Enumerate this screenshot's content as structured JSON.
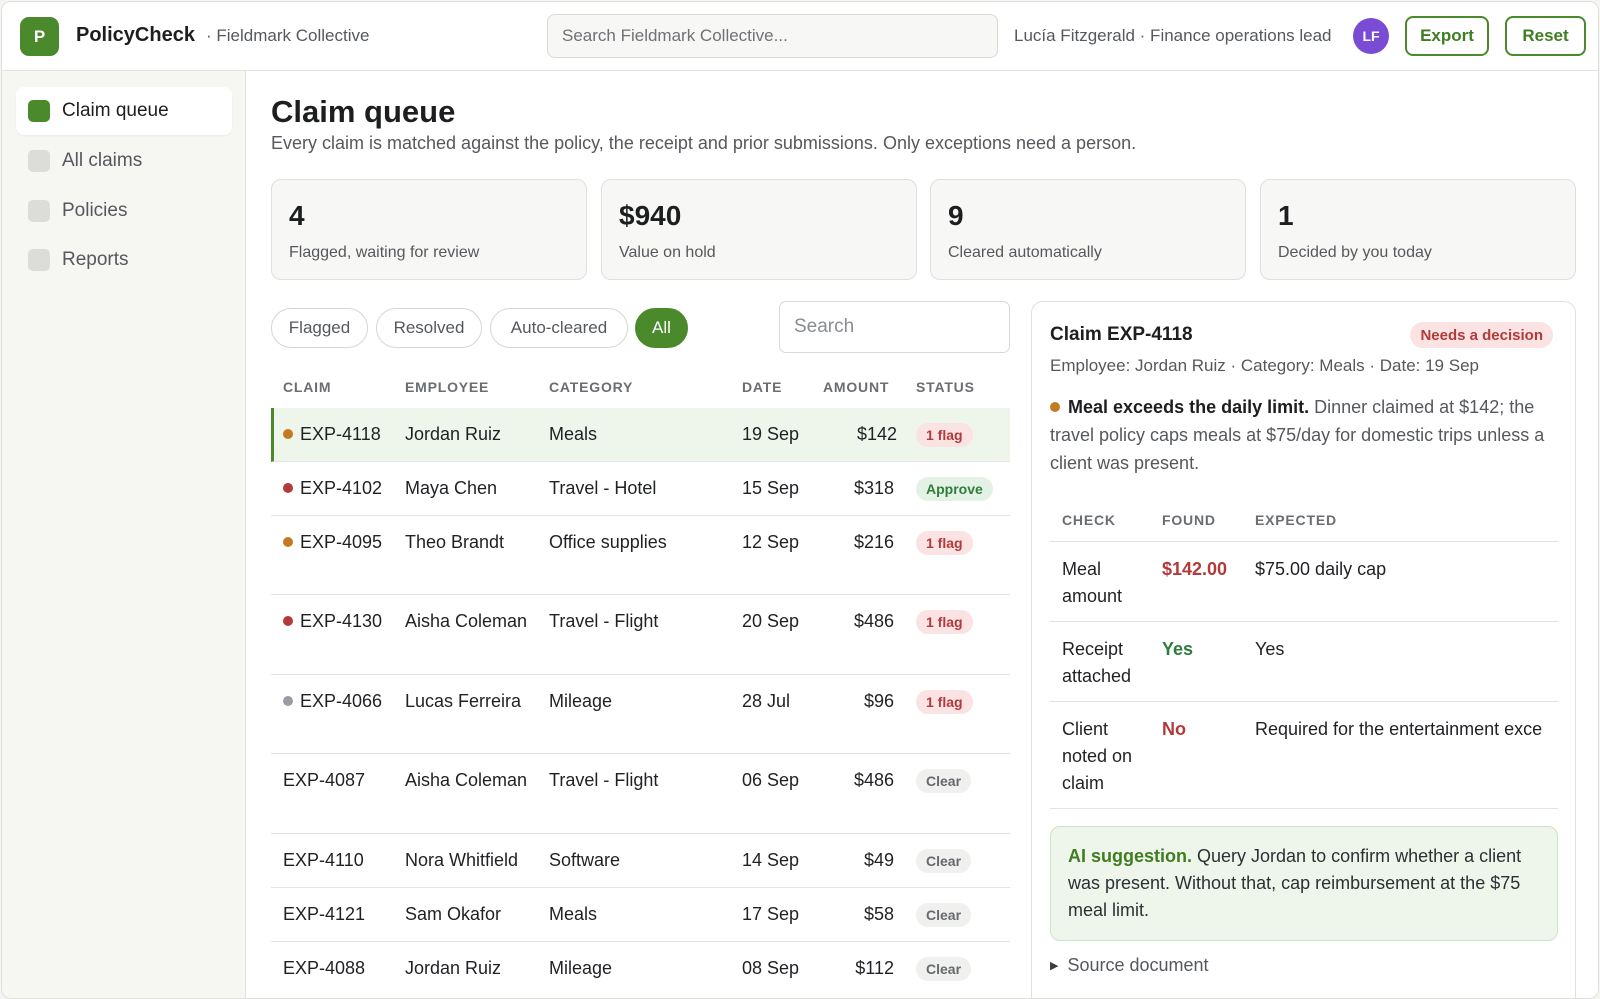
{
  "header": {
    "logo_letter": "P",
    "app_name": "PolicyCheck",
    "org": "· Fieldmark Collective",
    "search_placeholder": "Search Fieldmark Collective...",
    "user": "Lucía Fitzgerald · Finance operations lead",
    "avatar_initials": "LF",
    "export_label": "Export",
    "reset_label": "Reset"
  },
  "sidebar": {
    "items": [
      {
        "label": "Claim queue",
        "active": true
      },
      {
        "label": "All claims",
        "active": false
      },
      {
        "label": "Policies",
        "active": false
      },
      {
        "label": "Reports",
        "active": false
      }
    ]
  },
  "main": {
    "title": "Claim queue",
    "subtitle": "Every claim is matched against the policy, the receipt and prior submissions. Only exceptions need a person.",
    "stats": [
      {
        "value": "4",
        "label": "Flagged, waiting for review"
      },
      {
        "value": "$940",
        "label": "Value on hold"
      },
      {
        "value": "9",
        "label": "Cleared automatically"
      },
      {
        "value": "1",
        "label": "Decided by you today"
      }
    ],
    "filters": [
      {
        "label": "Flagged",
        "active": false
      },
      {
        "label": "Resolved",
        "active": false
      },
      {
        "label": "Auto-cleared",
        "active": false
      },
      {
        "label": "All",
        "active": true
      }
    ],
    "table_search_placeholder": "Search",
    "columns": [
      "CLAIM",
      "EMPLOYEE",
      "CATEGORY",
      "DATE",
      "AMOUNT",
      "STATUS"
    ],
    "rows": [
      {
        "claim": "EXP-4118",
        "employee": "Jordan Ruiz",
        "category": "Meals",
        "date": "19 Sep",
        "amount": "$142",
        "status": "1 flag",
        "status_type": "flag",
        "dot": "#c27a23"
      },
      {
        "claim": "EXP-4102",
        "employee": "Maya Chen",
        "category": "Travel - Hotel",
        "date": "15 Sep",
        "amount": "$318",
        "status": "Approve",
        "status_type": "approve",
        "dot": "#b23a3a"
      },
      {
        "claim": "EXP-4095",
        "employee": "Theo Brandt",
        "category": "Office supplies",
        "date": "12 Sep",
        "amount": "$216",
        "status": "1 flag",
        "status_type": "flag",
        "dot": "#c27a23"
      },
      {
        "claim": "EXP-4130",
        "employee": "Aisha Coleman",
        "category": "Travel - Flight",
        "date": "20 Sep",
        "amount": "$486",
        "status": "1 flag",
        "status_type": "flag",
        "dot": "#b23a3a"
      },
      {
        "claim": "EXP-4066",
        "employee": "Lucas Ferreira",
        "category": "Mileage",
        "date": "28 Jul",
        "amount": "$96",
        "status": "1 flag",
        "status_type": "flag",
        "dot": "#9a9da3"
      },
      {
        "claim": "EXP-4087",
        "employee": "Aisha Coleman",
        "category": "Travel - Flight",
        "date": "06 Sep",
        "amount": "$486",
        "status": "Clear",
        "status_type": "clear",
        "dot": ""
      },
      {
        "claim": "EXP-4110",
        "employee": "Nora Whitfield",
        "category": "Software",
        "date": "14 Sep",
        "amount": "$49",
        "status": "Clear",
        "status_type": "clear",
        "dot": ""
      },
      {
        "claim": "EXP-4121",
        "employee": "Sam Okafor",
        "category": "Meals",
        "date": "17 Sep",
        "amount": "$58",
        "status": "Clear",
        "status_type": "clear",
        "dot": ""
      },
      {
        "claim": "EXP-4088",
        "employee": "Jordan Ruiz",
        "category": "Mileage",
        "date": "08 Sep",
        "amount": "$112",
        "status": "Clear",
        "status_type": "clear",
        "dot": ""
      }
    ]
  },
  "detail": {
    "title": "Claim EXP-4118",
    "badge": "Needs a decision",
    "meta": "Employee: Jordan Ruiz · Category: Meals · Date: 19 Sep",
    "issue_title": "Meal exceeds the daily limit.",
    "issue_text": " Dinner claimed at $142; the travel policy caps meals at $75/day for domestic trips unless a client was present.",
    "check_columns": [
      "CHECK",
      "FOUND",
      "EXPECTED"
    ],
    "checks": [
      {
        "check": "Meal amount",
        "found": "$142.00",
        "found_ok": false,
        "expected": "$75.00 daily cap"
      },
      {
        "check": "Receipt attached",
        "found": "Yes",
        "found_ok": true,
        "expected": "Yes"
      },
      {
        "check": "Client noted on claim",
        "found": "No",
        "found_ok": false,
        "expected": "Required for the entertainment exce"
      }
    ],
    "ai_label": "AI suggestion.",
    "ai_text": " Query Jordan to confirm whether a client was present. Without that, cap reimbursement at the $75 meal limit.",
    "source_label": "Source document"
  },
  "colors": {
    "accent": "#4a8a2c",
    "flag": "#b23a3a",
    "ok": "#2f7d3c",
    "warn_dot": "#c27a23"
  }
}
